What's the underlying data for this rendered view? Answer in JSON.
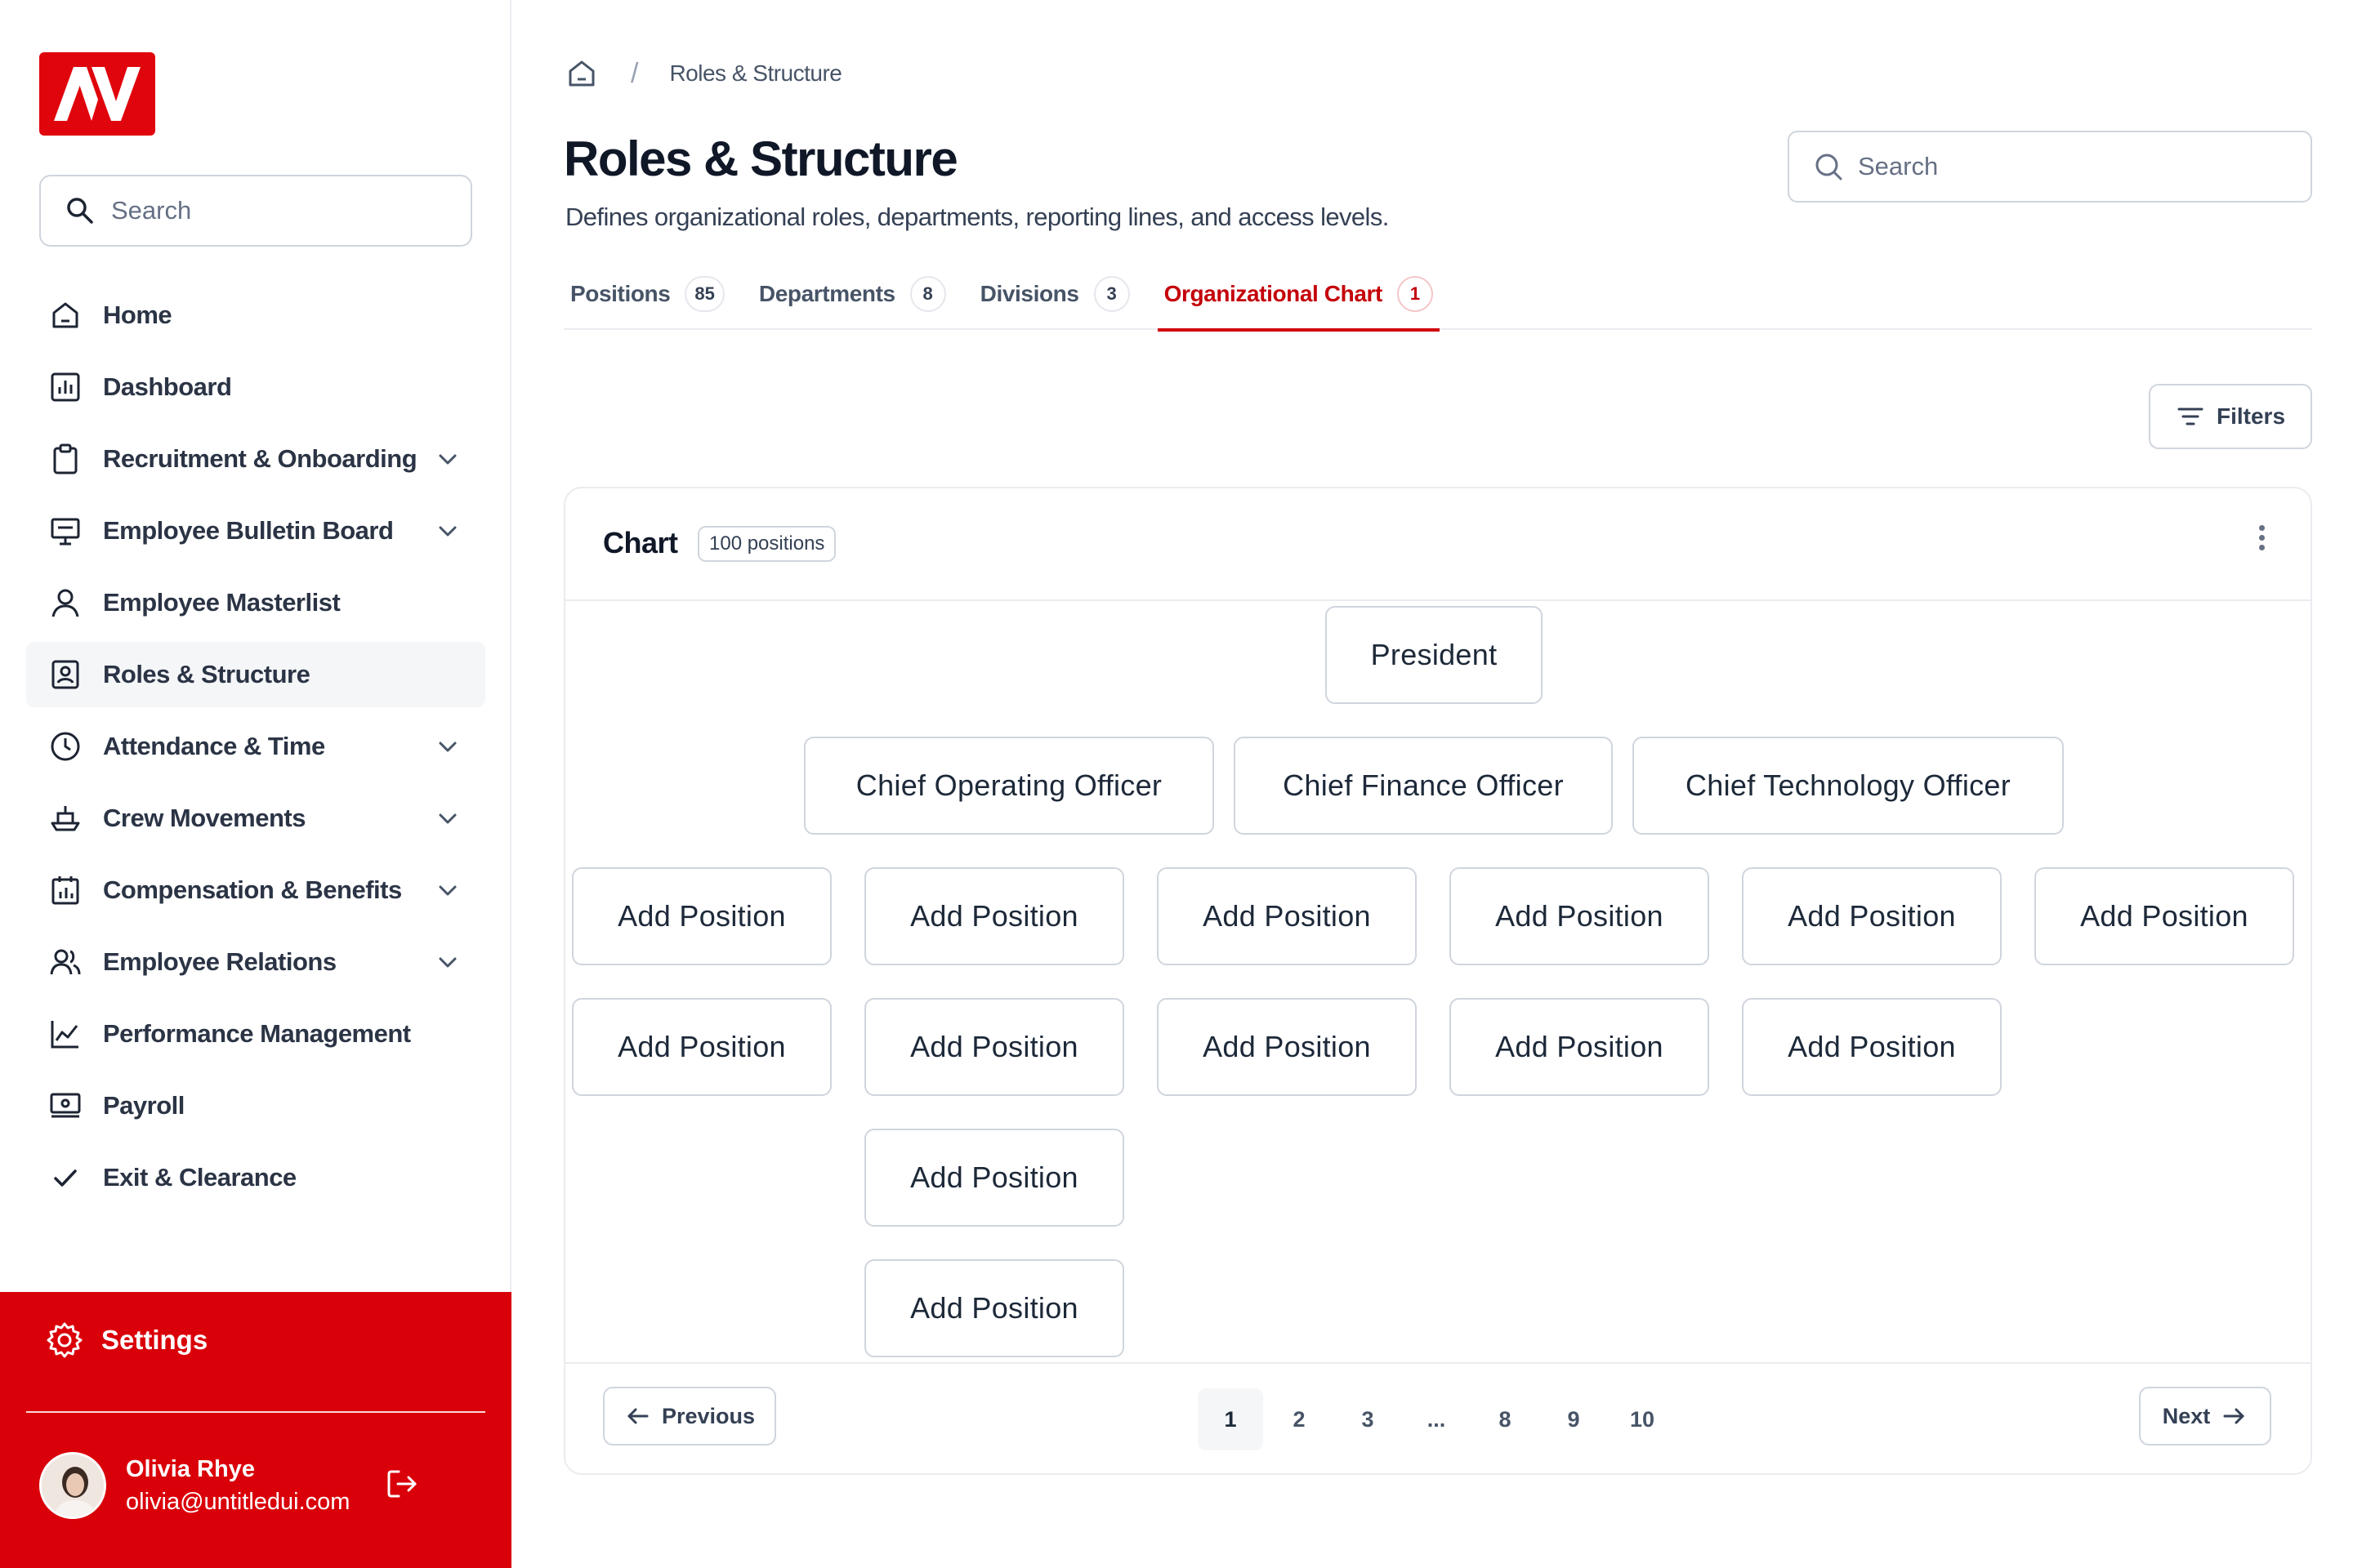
{
  "sidebar": {
    "logo_text": "AV",
    "search_placeholder": "Search",
    "items": [
      {
        "label": "Home",
        "icon": "home-icon",
        "has_chevron": false
      },
      {
        "label": "Dashboard",
        "icon": "bar-chart-icon",
        "has_chevron": false
      },
      {
        "label": "Recruitment & Onboarding",
        "icon": "clipboard-icon",
        "has_chevron": true
      },
      {
        "label": "Employee Bulletin Board",
        "icon": "presentation-icon",
        "has_chevron": true
      },
      {
        "label": "Employee Masterlist",
        "icon": "user-icon",
        "has_chevron": false
      },
      {
        "label": "Roles & Structure",
        "icon": "user-badge-icon",
        "has_chevron": false,
        "active": true
      },
      {
        "label": "Attendance & Time",
        "icon": "clock-icon",
        "has_chevron": true
      },
      {
        "label": "Crew Movements",
        "icon": "ship-icon",
        "has_chevron": true
      },
      {
        "label": "Compensation & Benefits",
        "icon": "calendar-chart-icon",
        "has_chevron": true
      },
      {
        "label": "Employee Relations",
        "icon": "users-icon",
        "has_chevron": true
      },
      {
        "label": "Performance Management",
        "icon": "line-chart-icon",
        "has_chevron": false
      },
      {
        "label": "Payroll",
        "icon": "payroll-icon",
        "has_chevron": false
      },
      {
        "label": "Exit & Clearance",
        "icon": "check-icon",
        "has_chevron": false
      }
    ],
    "settings_label": "Settings",
    "user": {
      "name": "Olivia Rhye",
      "email": "olivia@untitledui.com"
    }
  },
  "header": {
    "breadcrumb": "Roles & Structure",
    "title": "Roles & Structure",
    "subtitle": "Defines organizational roles, departments, reporting lines, and access levels.",
    "search_placeholder": "Search"
  },
  "tabs": [
    {
      "label": "Positions",
      "count": "85"
    },
    {
      "label": "Departments",
      "count": "8"
    },
    {
      "label": "Divisions",
      "count": "3"
    },
    {
      "label": "Organizational Chart",
      "count": "1",
      "active": true
    }
  ],
  "filters_label": "Filters",
  "chart_card": {
    "title": "Chart",
    "badge": "100 positions",
    "top": "President",
    "executives": [
      "Chief Operating Officer",
      "Chief Finance Officer",
      "Chief Technology Officer"
    ],
    "add_position_label": "Add Position",
    "add_rows": [
      6,
      5,
      1,
      1
    ]
  },
  "pagination": {
    "previous": "Previous",
    "next": "Next",
    "pages": [
      "1",
      "2",
      "3",
      "...",
      "8",
      "9",
      "10"
    ],
    "current": "1"
  },
  "colors": {
    "brand_red": "#da0009",
    "active_tab": "#c4000a"
  }
}
